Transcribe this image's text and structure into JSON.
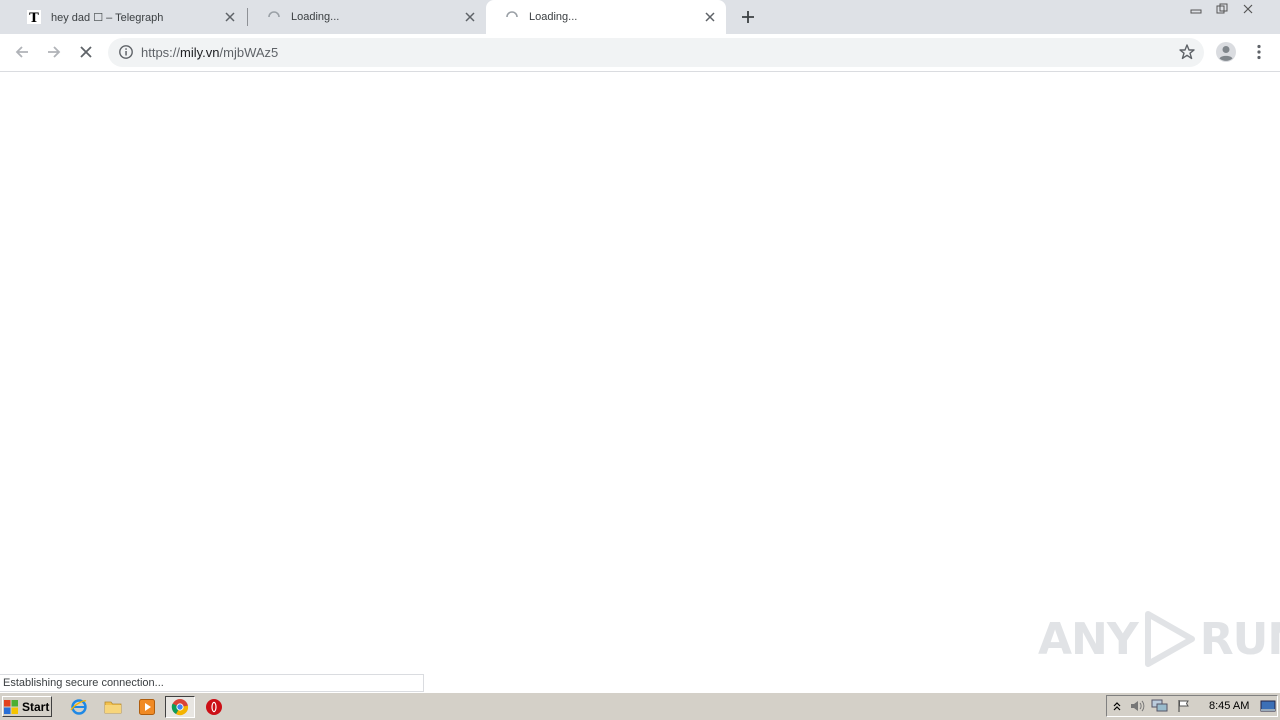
{
  "tabs": [
    {
      "favicon": "telegraph-T-icon",
      "favicon_letter": "T",
      "title": "hey dad ☐ – Telegraph"
    },
    {
      "favicon": "spinner-icon",
      "title": "Loading..."
    },
    {
      "favicon": "spinner-icon",
      "title": "Loading..."
    }
  ],
  "omnibox": {
    "scheme": "https://",
    "host": "mily.vn",
    "path": "/mjbWAz5"
  },
  "status_text": "Establishing secure connection...",
  "watermark": {
    "left": "ANY",
    "right": "RUN"
  },
  "taskbar": {
    "start_label": "Start",
    "clock": "8:45 AM"
  },
  "colors": {
    "tabstrip": "#dee1e6",
    "omnibox": "#f1f3f4",
    "taskbar": "#d4d0c8"
  }
}
